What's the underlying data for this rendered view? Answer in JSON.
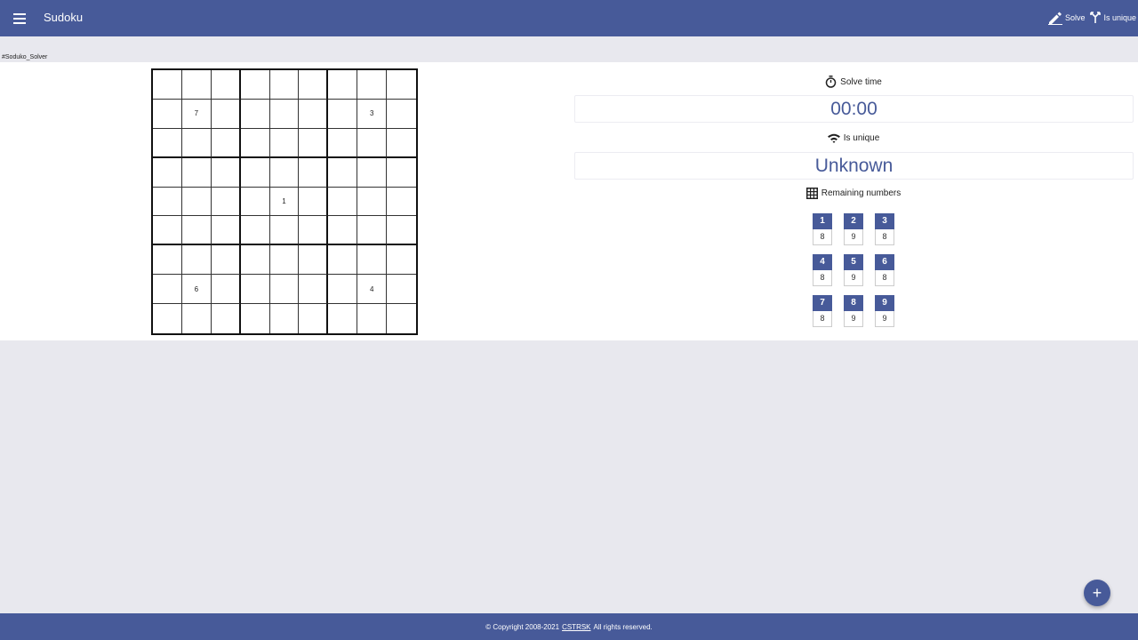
{
  "header": {
    "title": "Sudoku",
    "actions": [
      {
        "label": "Solve",
        "icon": "pencil-icon"
      },
      {
        "label": "Is unique",
        "icon": "fork-icon"
      }
    ]
  },
  "anchor_label": "#Soduko_Solver",
  "grid": [
    [
      "",
      "",
      "",
      "",
      "",
      "",
      "",
      "",
      ""
    ],
    [
      "",
      "7",
      "",
      "",
      "",
      "",
      "",
      "3",
      ""
    ],
    [
      "",
      "",
      "",
      "",
      "",
      "",
      "",
      "",
      ""
    ],
    [
      "",
      "",
      "",
      "",
      "",
      "",
      "",
      "",
      ""
    ],
    [
      "",
      "",
      "",
      "",
      "1",
      "",
      "",
      "",
      ""
    ],
    [
      "",
      "",
      "",
      "",
      "",
      "",
      "",
      "",
      ""
    ],
    [
      "",
      "",
      "",
      "",
      "",
      "",
      "",
      "",
      ""
    ],
    [
      "",
      "6",
      "",
      "",
      "",
      "",
      "",
      "4",
      ""
    ],
    [
      "",
      "",
      "",
      "",
      "",
      "",
      "",
      "",
      ""
    ]
  ],
  "stats": {
    "solve_time_label": "Solve time",
    "solve_time_value": "00:00",
    "unique_label": "Is unique",
    "unique_value": "Unknown",
    "remaining_label": "Remaining numbers",
    "remaining": [
      {
        "number": "1",
        "count": "8"
      },
      {
        "number": "2",
        "count": "9"
      },
      {
        "number": "3",
        "count": "8"
      },
      {
        "number": "4",
        "count": "8"
      },
      {
        "number": "5",
        "count": "9"
      },
      {
        "number": "6",
        "count": "8"
      },
      {
        "number": "7",
        "count": "8"
      },
      {
        "number": "8",
        "count": "9"
      },
      {
        "number": "9",
        "count": "9"
      }
    ]
  },
  "fab_symbol": "+",
  "footer": {
    "prefix": "© Copyright 2008-2021",
    "link": "CSTRSK",
    "suffix": "All rights reserved."
  },
  "colors": {
    "primary": "#475a99",
    "background": "#e8e8ee"
  }
}
